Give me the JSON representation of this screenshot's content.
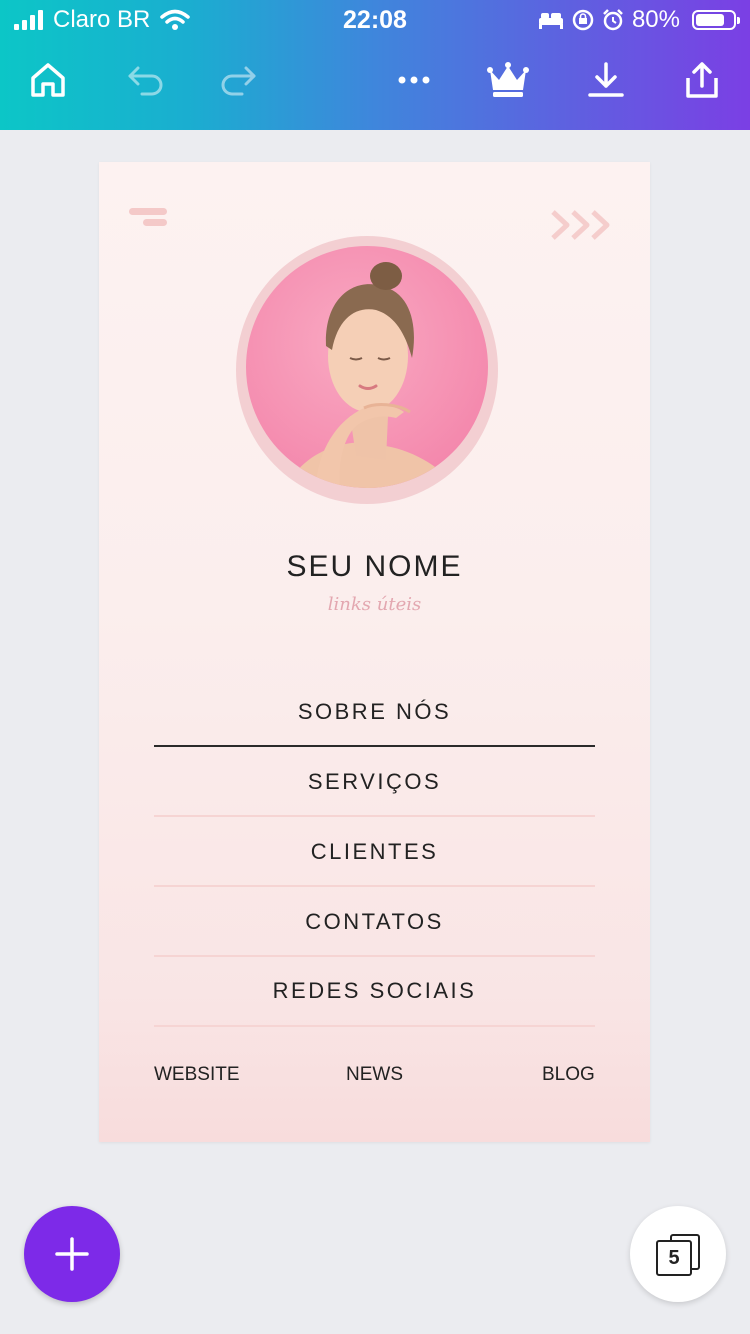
{
  "status_bar": {
    "carrier": "Claro BR",
    "time": "22:08",
    "battery": "80%",
    "battery_level": 0.8
  },
  "toolbar": {
    "icons": [
      "home-icon",
      "undo-icon",
      "redo-icon",
      "more-icon",
      "crown-icon",
      "download-icon",
      "share-icon"
    ]
  },
  "design": {
    "name": "SEU NOME",
    "subtitle": "links úteis",
    "menu": [
      "SOBRE NÓS",
      "SERVIÇOS",
      "CLIENTES",
      "CONTATOS",
      "REDES SOCIAIS"
    ],
    "footer_links": [
      "WEBSITE",
      "NEWS",
      "BLOG"
    ]
  },
  "fab": {
    "icon": "plus-icon"
  },
  "pages": {
    "count": "5"
  },
  "colors": {
    "accent": "#7d2ae8",
    "gradient_start": "#0cc6c7",
    "gradient_end": "#7b3fe4",
    "canvas_pink": "#fbeeed",
    "photo_pink": "#f58fb1"
  }
}
